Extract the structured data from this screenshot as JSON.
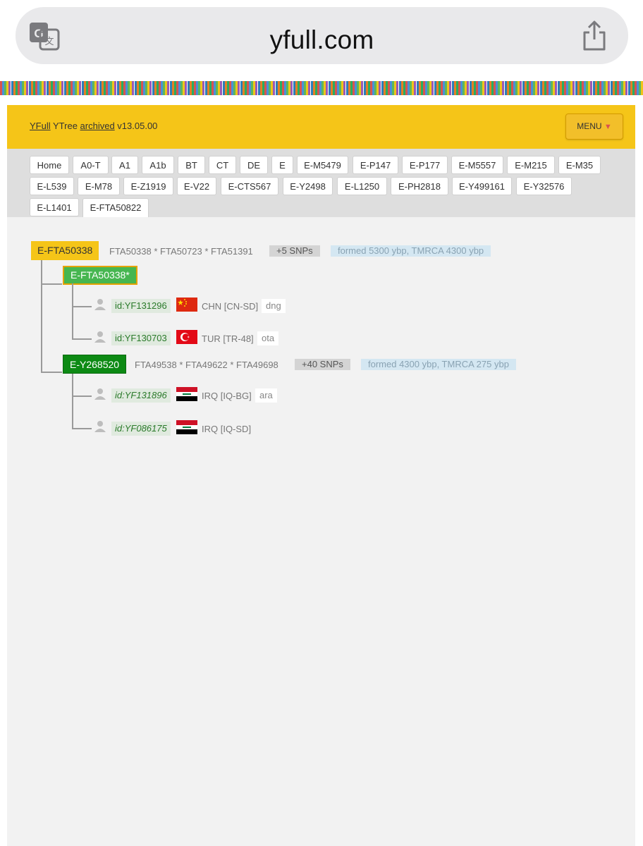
{
  "browser": {
    "url": "yfull.com",
    "icons": [
      "translate-icon",
      "share-icon"
    ]
  },
  "header": {
    "brand_link": "YFull",
    "brand_mid": " YTree ",
    "archived_link": "archived",
    "version": " v13.05.00",
    "menu_label": "MENU",
    "menu_caret": "▼",
    "accent": "#f5c518"
  },
  "nav": {
    "tabs": [
      "Home",
      "A0-T",
      "A1",
      "A1b",
      "BT",
      "CT",
      "DE",
      "E",
      "E-M5479",
      "E-P147",
      "E-P177",
      "E-M5557",
      "E-M215",
      "E-M35",
      "E-L539",
      "E-M78",
      "E-Z1919",
      "E-V22",
      "E-CTS567",
      "E-Y2498",
      "E-L1250",
      "E-PH2818",
      "E-Y499161",
      "E-Y32576",
      "E-L1401",
      "E-FTA50822"
    ]
  },
  "tree": {
    "root": {
      "name": "E-FTA50338",
      "snps": "FTA50338 * FTA50723 * FTA51391",
      "snp_count": "+5 SNPs",
      "formed": "formed 5300 ybp, TMRCA 4300 ybp"
    },
    "branch1": {
      "name": "E-FTA50338*",
      "samples": [
        {
          "id": "id:YF131296",
          "country": "CHN [CN-SD]",
          "lang": "dng",
          "flag": "china-flag"
        },
        {
          "id": "id:YF130703",
          "country": "TUR [TR-48]",
          "lang": "ota",
          "flag": "turkey-flag"
        }
      ]
    },
    "branch2": {
      "name": "E-Y268520",
      "snps": "FTA49538 * FTA49622 * FTA49698",
      "snp_count": "+40 SNPs",
      "formed": "formed 4300 ybp, TMRCA 275 ybp",
      "samples": [
        {
          "id": "id:YF131896",
          "country": "IRQ [IQ-BG]",
          "lang": "ara",
          "flag": "iraq-flag"
        },
        {
          "id": "id:YF086175",
          "country": "IRQ [IQ-SD]",
          "lang": "",
          "flag": "iraq-flag"
        }
      ]
    }
  }
}
